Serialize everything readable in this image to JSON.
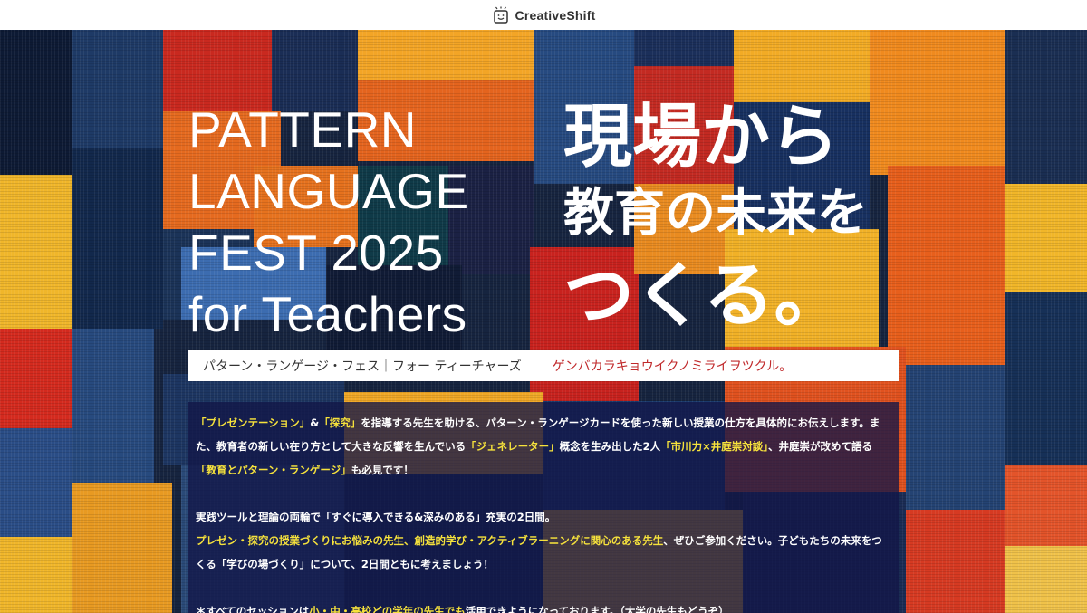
{
  "header": {
    "brand_name": "CreativeShift"
  },
  "hero": {
    "en_title_lines": [
      "PATTERN",
      "LANGUAGE",
      "FEST 2025",
      "for Teachers"
    ],
    "jp_title_lines": [
      "現場から",
      "教育の未来を",
      "つくる。"
    ],
    "reading_en": "パターン・ランゲージ・フェス｜フォー ティーチャーズ",
    "reading_jp": "ゲンバカラキョウイクノミライヲツクル。"
  },
  "description": {
    "p1": {
      "h1": "「プレゼンテーション」",
      "t1": "&",
      "h2": "「探究」",
      "t2": "を指導する先生を助ける、パターン・ランゲージカードを使った新しい授業の仕方を具体的にお伝えします。また、教育者の新しい在り方として大きな反響を生んでいる",
      "h3": "「ジェネレーター」",
      "t3": "概念を生み出した2人",
      "h4": "「市川力×井庭崇対談」",
      "t4": "、井庭崇が改めて語る",
      "h5": "「教育とパターン・ランゲージ」",
      "t5": "も必見です！"
    },
    "p2": {
      "t1": "実践ツールと理論の両輪で「すぐに導入できる&深みのある」充実の2日間。",
      "h1": "プレゼン・探究の授業づくりにお悩みの先生、創造的学び・アクティブラーニングに関心のある先生",
      "t2": "、ぜひご参加ください。子どもたちの未来をつくる「学びの場づくり」について、2日間ともに考えましょう！"
    },
    "p3": {
      "t1": "＊すべてのセッションは",
      "h1": "小・中・高校どの学年の先生でも",
      "t2": "活用できようになっております。（大学の先生もどうぞ）"
    }
  },
  "colors": {
    "highlight": "#f6e23c",
    "reading_accent": "#c0292b",
    "panel": "#121648"
  }
}
